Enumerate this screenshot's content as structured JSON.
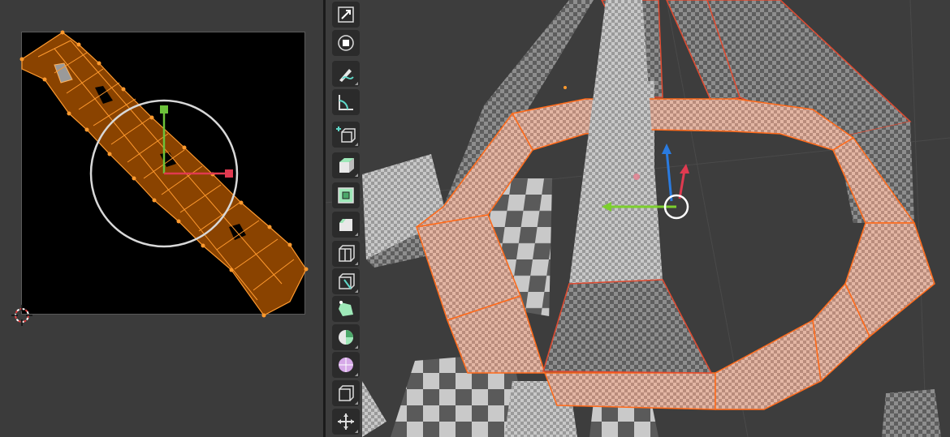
{
  "uv_editor": {
    "background_color": "#000000",
    "island_color": "#8a4300",
    "edge_color": "#ff9a2e",
    "selected_face_color": "#9a9a9a"
  },
  "toolbar": {
    "tools": [
      {
        "name": "scale-cage-icon",
        "has_submenu": false
      },
      {
        "name": "transform-icon",
        "has_submenu": false
      },
      {
        "name": "annotate-icon",
        "has_submenu": true
      },
      {
        "name": "measure-icon",
        "has_submenu": false
      },
      {
        "name": "add-cube-icon",
        "has_submenu": true
      },
      {
        "name": "extrude-region-icon",
        "has_submenu": true
      },
      {
        "name": "inset-faces-icon",
        "has_submenu": false
      },
      {
        "name": "bevel-icon",
        "has_submenu": true
      },
      {
        "name": "loop-cut-icon",
        "has_submenu": true
      },
      {
        "name": "knife-icon",
        "has_submenu": true
      },
      {
        "name": "poly-build-icon",
        "has_submenu": false
      },
      {
        "name": "spin-icon",
        "has_submenu": true
      },
      {
        "name": "smooth-icon",
        "has_submenu": true
      },
      {
        "name": "edge-slide-icon",
        "has_submenu": true
      },
      {
        "name": "shrink-fatten-icon",
        "has_submenu": true
      }
    ]
  },
  "viewport": {
    "background_color": "#3d3d3d",
    "gizmo_colors": {
      "x": "#e03a50",
      "y": "#7ccf2e",
      "z": "#2a7be0"
    },
    "selection_outline": "#ff6a1a"
  }
}
